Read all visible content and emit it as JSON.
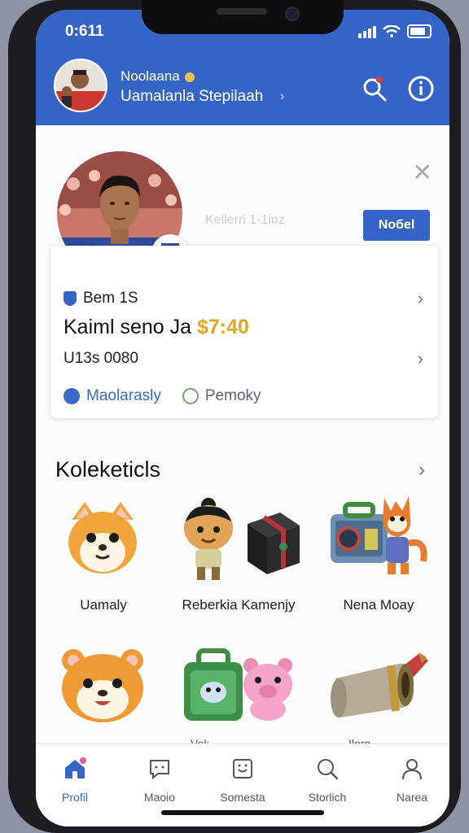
{
  "status": {
    "time": "0:611"
  },
  "header": {
    "name": "Noolaana",
    "subtitle": "Uamalanla Stepilaah"
  },
  "profile": {
    "ghost_text": "Kellerri 1-1ioz",
    "note_button": "Noбel"
  },
  "card": {
    "row1": "Bem 1S",
    "row2_text": "Kaiml seno Ja",
    "row2_price": "$7:40",
    "row3": "U13s 0080",
    "chip1": "Maolarasly",
    "chip2": "Pemoky"
  },
  "collection": {
    "title": "Koleketicls",
    "items": [
      {
        "label": "Uamaly"
      },
      {
        "label": "Reberkia Kamenjy"
      },
      {
        "label": "Nena Moay"
      }
    ],
    "partial_labels": [
      "Vel:",
      "Ilorn"
    ]
  },
  "tabs": [
    {
      "label": "Profil",
      "active": true
    },
    {
      "label": "Maoio"
    },
    {
      "label": "Somesta"
    },
    {
      "label": "Storlich"
    },
    {
      "label": "Narea"
    }
  ],
  "colors": {
    "accent": "#3564c7",
    "price": "#e6a31f"
  }
}
